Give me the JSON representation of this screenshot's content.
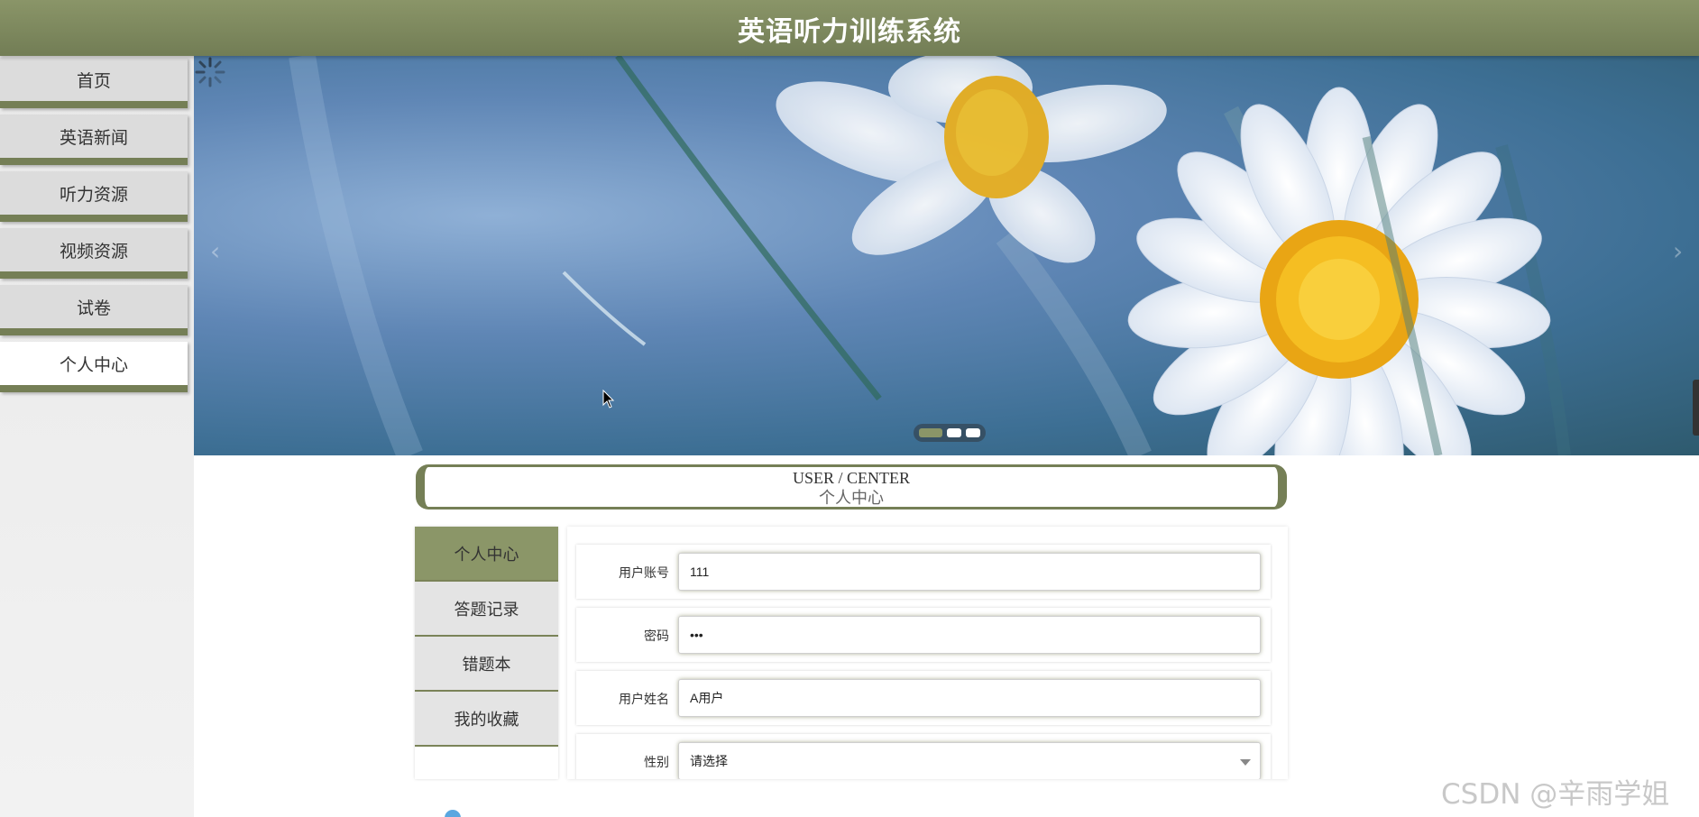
{
  "app": {
    "title": "英语听力训练系统"
  },
  "sidebar": {
    "items": [
      {
        "label": "首页",
        "active": false
      },
      {
        "label": "英语新闻",
        "active": false
      },
      {
        "label": "听力资源",
        "active": false
      },
      {
        "label": "视频资源",
        "active": false
      },
      {
        "label": "试卷",
        "active": false
      },
      {
        "label": "个人中心",
        "active": true
      }
    ]
  },
  "banner": {
    "prev_icon": "chevron-left-icon",
    "next_icon": "chevron-right-icon",
    "slide_count": 3,
    "active_slide": 1
  },
  "section": {
    "title_en": "USER / CENTER",
    "title_cn": "个人中心"
  },
  "user_center": {
    "tabs": [
      {
        "label": "个人中心",
        "active": true
      },
      {
        "label": "答题记录",
        "active": false
      },
      {
        "label": "错题本",
        "active": false
      },
      {
        "label": "我的收藏",
        "active": false
      }
    ],
    "form": {
      "account_label": "用户账号",
      "account_value": "111",
      "password_label": "密码",
      "password_value": "•••",
      "name_label": "用户姓名",
      "name_value": "A用户",
      "gender_label": "性别",
      "gender_value": "请选择"
    }
  },
  "watermark": "CSDN @辛雨学姐",
  "colors": {
    "accent": "#757f56",
    "header": "#7f8a5e",
    "active_tab": "#8b9668"
  }
}
